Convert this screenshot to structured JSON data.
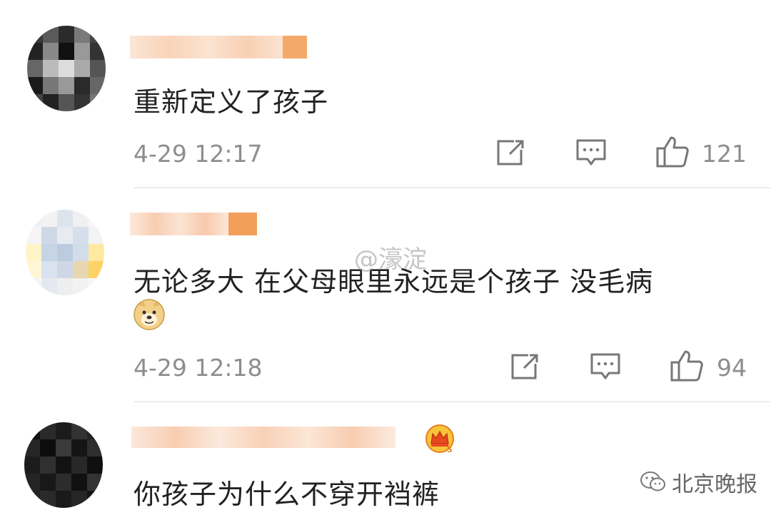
{
  "comments": [
    {
      "text": "重新定义了孩子",
      "time": "4-29 12:17",
      "likes": "121",
      "badge": "none"
    },
    {
      "text": "无论多大 在父母眼里永远是个孩子 没毛病",
      "time": "4-29 12:18",
      "likes": "94",
      "badge": "dog-emoji"
    },
    {
      "text": "你孩子为什么不穿开裆裤",
      "badge": "crown-vip"
    }
  ],
  "watermark": "@濠淀",
  "brand": {
    "label": "北京晚报",
    "icon": "wechat-icon"
  },
  "colors": {
    "text": "#222222",
    "meta": "#8e8e8e",
    "divider": "#ececec",
    "blur_orange": "#f4b07a",
    "blur_peach": "#f9d9c0"
  }
}
